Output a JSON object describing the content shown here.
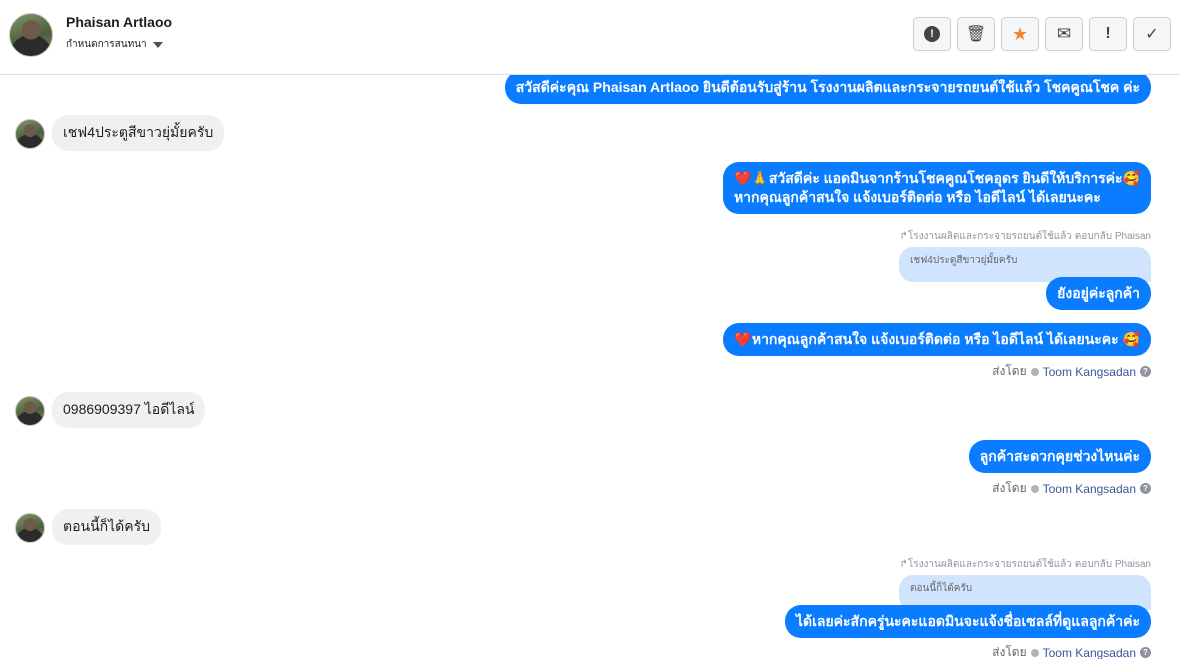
{
  "header": {
    "name": "Phaisan Artlaoo",
    "assign_label": "กำหนดการสนทนา",
    "toolbar": {
      "spam": "!",
      "trash": "🗑",
      "star": "★",
      "mail": "✉",
      "important": "!",
      "done": "✓"
    },
    "colors": {
      "star": "#f5862e",
      "accent": "#0a7cff"
    }
  },
  "messages": {
    "m1": "สวัสดีค่ะคุณ Phaisan Artlaoo ยินดีต้อนรับสู่ร้าน โรงงานผลิตและกระจายรถยนต์ใช้แล้ว โชคคูณโชค ค่ะ",
    "m2": "เชฟ4ประตูสีขาวยุ่มั้ยครับ",
    "m3_heart": "❤️",
    "m3_pray": "🙏",
    "m3_line1": "สวัสดีค่ะ แอดมินจากร้านโชคคูณโชคอุดร ยินดีให้บริการค่ะ🥰",
    "m3_line2": "หากคุณลูกค้าสนใจ แจ้งเบอร์ติดต่อ หรือ ไอดีไลน์ ได้เลยนะคะ",
    "m4_replied": "↱โรงงานผลิตและกระจายรถยนต์ใช้แล้ว ตอบกลับ Phaisan",
    "m4_quote": "เชฟ4ประตูสีขาวยุ่มั้ยครับ",
    "m4": "ยังอยู่ค่ะลูกค้า",
    "m5_heart": "❤️",
    "m5": "หากคุณลูกค้าสนใจ แจ้งเบอร์ติดต่อ หรือ ไอดีไลน์ ได้เลยนะคะ 🥰",
    "sent_label": "ส่งโดย",
    "agent": "Toom Kangsadan",
    "help": "?",
    "m6": "0986909397  ไอดีไลน์",
    "m7": "ลูกค้าสะดวกคุยช่วงไหนค่ะ",
    "m8": "ตอนนี้ก็ได้ครับ",
    "m9_replied": "↱โรงงานผลิตและกระจายรถยนต์ใช้แล้ว ตอบกลับ Phaisan",
    "m9_quote": "ตอนนี้ก็ได้ครับ",
    "m9": "ได้เลยค่ะสักครู่นะคะแอดมินจะแจ้งชื่อเซลล์ที่ดูแลลูกค้าค่ะ"
  }
}
